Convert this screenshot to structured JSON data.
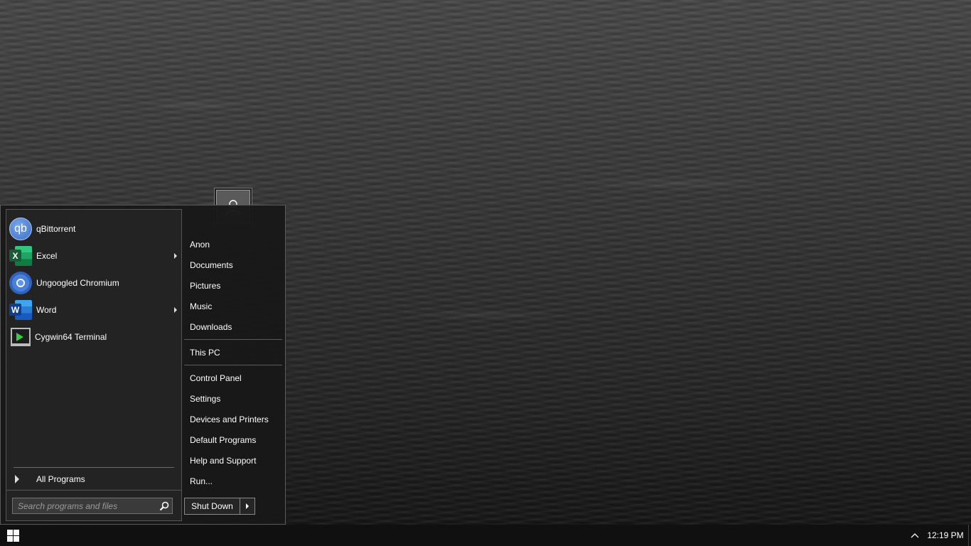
{
  "start_menu": {
    "pinned": [
      {
        "label": "qBittorrent",
        "icon": "qbittorrent-icon",
        "icon_text": "qb",
        "submenu": false
      },
      {
        "label": "Excel",
        "icon": "excel-icon",
        "icon_text": "X",
        "submenu": true
      },
      {
        "label": "Ungoogled Chromium",
        "icon": "chromium-icon",
        "submenu": false
      },
      {
        "label": "Word",
        "icon": "word-icon",
        "icon_text": "W",
        "submenu": true
      },
      {
        "label": "Cygwin64 Terminal",
        "icon": "terminal-icon",
        "submenu": false
      }
    ],
    "all_programs_label": "All Programs",
    "search_placeholder": "Search programs and files",
    "right_items": {
      "user": "Anon",
      "documents": "Documents",
      "pictures": "Pictures",
      "music": "Music",
      "downloads": "Downloads",
      "this_pc": "This PC",
      "control_panel": "Control Panel",
      "settings": "Settings",
      "devices_printers": "Devices and Printers",
      "default_programs": "Default Programs",
      "help_support": "Help and Support",
      "run": "Run..."
    },
    "shutdown_label": "Shut Down"
  },
  "taskbar": {
    "clock": "12:19 PM"
  },
  "colors": {
    "menu_bg": "#181818",
    "taskbar_bg": "#101010",
    "text": "#ffffff"
  }
}
